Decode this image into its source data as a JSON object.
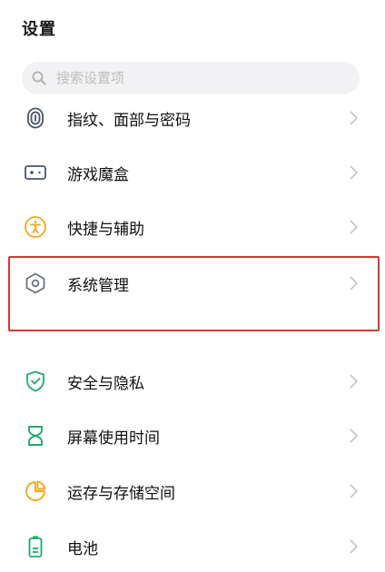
{
  "header": {
    "title": "设置"
  },
  "search": {
    "placeholder": "搜索设置项"
  },
  "items": [
    {
      "label": "指纹、面部与密码",
      "icon": "fingerprint-icon",
      "color": "#4b5568"
    },
    {
      "label": "游戏魔盒",
      "icon": "gamepad-icon",
      "color": "#4b5568"
    },
    {
      "label": "快捷与辅助",
      "icon": "accessibility-icon",
      "color": "#f0a81e"
    },
    {
      "label": "系统管理",
      "icon": "gear-hexagon-icon",
      "color": "#6b7280"
    },
    {
      "label": "安全与隐私",
      "icon": "shield-check-icon",
      "color": "#22a96b"
    },
    {
      "label": "屏幕使用时间",
      "icon": "hourglass-icon",
      "color": "#22a96b"
    },
    {
      "label": "运存与存储空间",
      "icon": "pie-chart-icon",
      "color": "#f0a81e"
    },
    {
      "label": "电池",
      "icon": "battery-icon",
      "color": "#22a96b"
    }
  ],
  "highlight_color": "#d03a36"
}
